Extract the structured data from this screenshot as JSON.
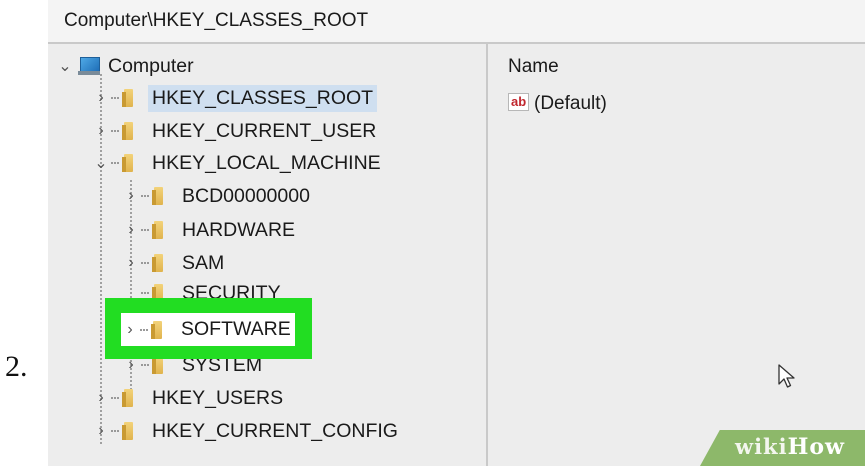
{
  "step": {
    "number": "2."
  },
  "address_bar": {
    "path": "Computer\\HKEY_CLASSES_ROOT"
  },
  "tree": {
    "root": {
      "label": "Computer",
      "icon": "computer-icon"
    },
    "hkey_classes_root": {
      "label": "HKEY_CLASSES_ROOT",
      "selected": true
    },
    "hkey_current_user": {
      "label": "HKEY_CURRENT_USER"
    },
    "hkey_local_machine": {
      "label": "HKEY_LOCAL_MACHINE",
      "expanded": true
    },
    "bcd": {
      "label": "BCD00000000"
    },
    "hardware": {
      "label": "HARDWARE"
    },
    "sam": {
      "label": "SAM"
    },
    "security": {
      "label": "SECURITY"
    },
    "software": {
      "label": "SOFTWARE",
      "highlighted": true
    },
    "system": {
      "label": "SYSTEM"
    },
    "hkey_users": {
      "label": "HKEY_USERS"
    },
    "hkey_current_config": {
      "label": "HKEY_CURRENT_CONFIG"
    }
  },
  "values_pane": {
    "column_name": "Name",
    "entries": [
      {
        "name": "(Default)",
        "icon": "string-value-icon"
      }
    ]
  },
  "watermark": {
    "wiki": "wiki",
    "how": "How"
  },
  "colors": {
    "highlight": "#22dd22",
    "selection": "#cfdff0",
    "watermark_band": "#8db86a"
  }
}
